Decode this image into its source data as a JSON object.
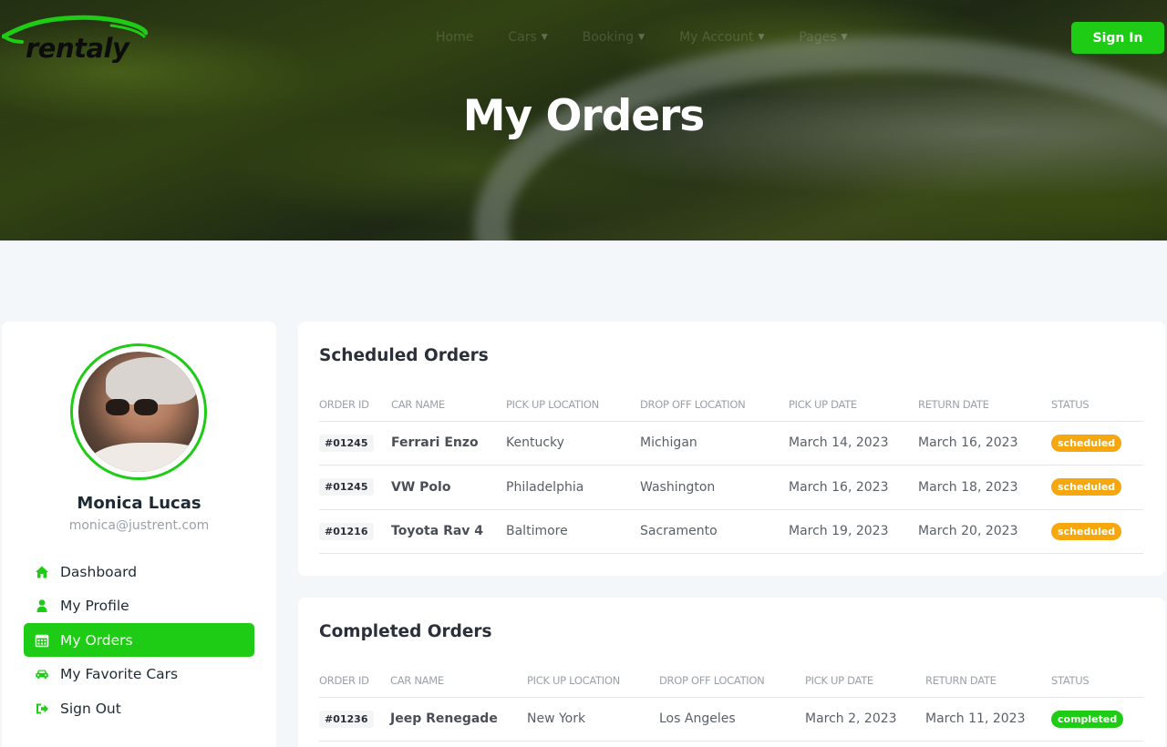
{
  "brand": {
    "name": "rentaly",
    "accent": "#1ecb15"
  },
  "nav": {
    "items": [
      {
        "label": "Home",
        "dropdown": false
      },
      {
        "label": "Cars",
        "dropdown": true
      },
      {
        "label": "Booking",
        "dropdown": true
      },
      {
        "label": "My Account",
        "dropdown": true
      },
      {
        "label": "Pages",
        "dropdown": true
      }
    ],
    "sign_in": "Sign In"
  },
  "page": {
    "title": "My Orders"
  },
  "profile": {
    "name": "Monica Lucas",
    "email": "monica@justrent.com"
  },
  "sidebar": {
    "items": [
      {
        "label": "Dashboard",
        "icon": "home-icon",
        "active": false
      },
      {
        "label": "My Profile",
        "icon": "user-icon",
        "active": false
      },
      {
        "label": "My Orders",
        "icon": "calendar-icon",
        "active": true
      },
      {
        "label": "My Favorite Cars",
        "icon": "car-icon",
        "active": false
      },
      {
        "label": "Sign Out",
        "icon": "sign-out-icon",
        "active": false
      }
    ]
  },
  "scheduled": {
    "title": "Scheduled Orders",
    "headers": [
      "ORDER ID",
      "CAR NAME",
      "PICK UP LOCATION",
      "DROP OFF LOCATION",
      "PICK UP DATE",
      "RETURN DATE",
      "STATUS"
    ],
    "rows": [
      {
        "id": "#01245",
        "car": "Ferrari Enzo",
        "pickup": "Kentucky",
        "dropoff": "Michigan",
        "pickup_date": "March 14, 2023",
        "return_date": "March 16, 2023",
        "status": "scheduled"
      },
      {
        "id": "#01245",
        "car": "VW Polo",
        "pickup": "Philadelphia",
        "dropoff": "Washington",
        "pickup_date": "March 16, 2023",
        "return_date": "March 18, 2023",
        "status": "scheduled"
      },
      {
        "id": "#01216",
        "car": "Toyota Rav 4",
        "pickup": "Baltimore",
        "dropoff": "Sacramento",
        "pickup_date": "March 19, 2023",
        "return_date": "March 20, 2023",
        "status": "scheduled"
      }
    ]
  },
  "completed": {
    "title": "Completed Orders",
    "headers": [
      "ORDER ID",
      "CAR NAME",
      "PICK UP LOCATION",
      "DROP OFF LOCATION",
      "PICK UP DATE",
      "RETURN DATE",
      "STATUS"
    ],
    "rows": [
      {
        "id": "#01236",
        "car": "Jeep Renegade",
        "pickup": "New York",
        "dropoff": "Los Angeles",
        "pickup_date": "March 2, 2023",
        "return_date": "March 11, 2023",
        "status": "completed"
      }
    ]
  }
}
